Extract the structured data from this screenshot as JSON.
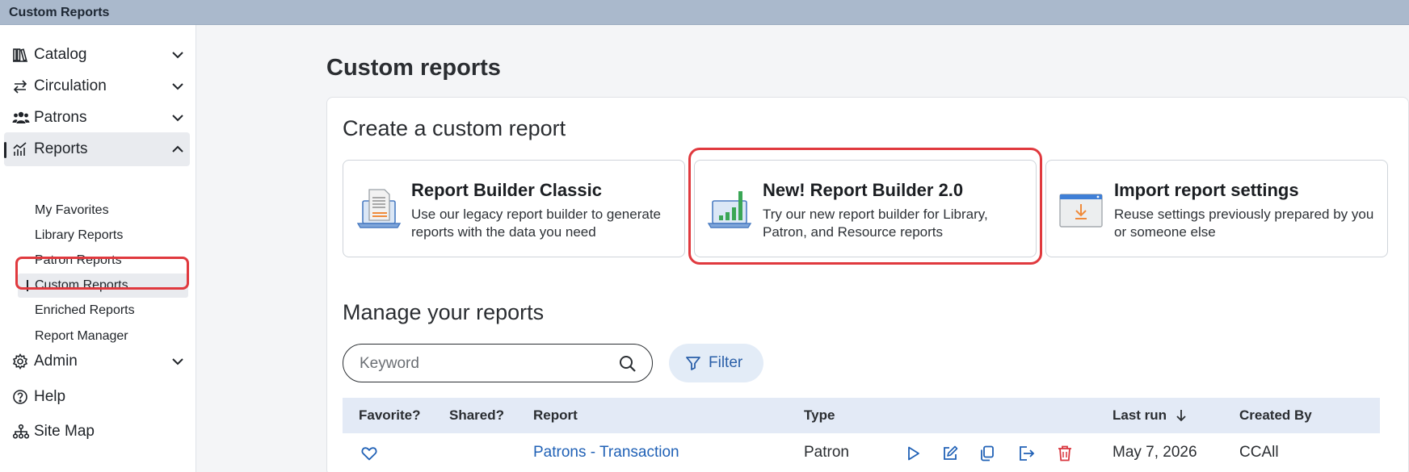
{
  "window": {
    "title": "Custom Reports"
  },
  "sidebar": {
    "items": [
      {
        "label": "Catalog",
        "icon": "catalog-icon"
      },
      {
        "label": "Circulation",
        "icon": "circulation-icon"
      },
      {
        "label": "Patrons",
        "icon": "patrons-icon"
      },
      {
        "label": "Reports",
        "icon": "reports-icon",
        "expanded": true
      },
      {
        "label": "Admin",
        "icon": "gear-icon"
      },
      {
        "label": "Help",
        "icon": "help-icon"
      },
      {
        "label": "Site Map",
        "icon": "sitemap-icon"
      }
    ],
    "reports_sub": [
      {
        "label": "My Favorites"
      },
      {
        "label": "Library Reports"
      },
      {
        "label": "Patron Reports"
      },
      {
        "label": "Custom Reports",
        "selected": true
      },
      {
        "label": "Enriched Reports"
      },
      {
        "label": "Report Manager"
      }
    ]
  },
  "main": {
    "title": "Custom reports",
    "create": {
      "heading": "Create a custom report",
      "cards": [
        {
          "title": "Report Builder Classic",
          "description": "Use our legacy report builder to generate reports with the data you need"
        },
        {
          "title": "New! Report Builder 2.0",
          "description": "Try our new report builder for Library, Patron, and Resource reports"
        },
        {
          "title": "Import report settings",
          "description": "Reuse settings previously prepared by you or someone else"
        }
      ]
    },
    "manage": {
      "heading": "Manage your reports",
      "search_placeholder": "Keyword",
      "search_value": "",
      "filter_label": "Filter",
      "columns": [
        "Favorite?",
        "Shared?",
        "Report",
        "Type",
        "Last run",
        "Created By"
      ],
      "sort_column": "Last run",
      "rows": [
        {
          "report": "Patrons - Transaction",
          "type": "Patron",
          "last_run": "May 7, 2026",
          "created_by": "CCAll"
        }
      ]
    }
  },
  "colors": {
    "accent": "#2061b6",
    "highlight": "#e0393e",
    "delete": "#d9363e",
    "header_bar": "#aab9cc"
  }
}
